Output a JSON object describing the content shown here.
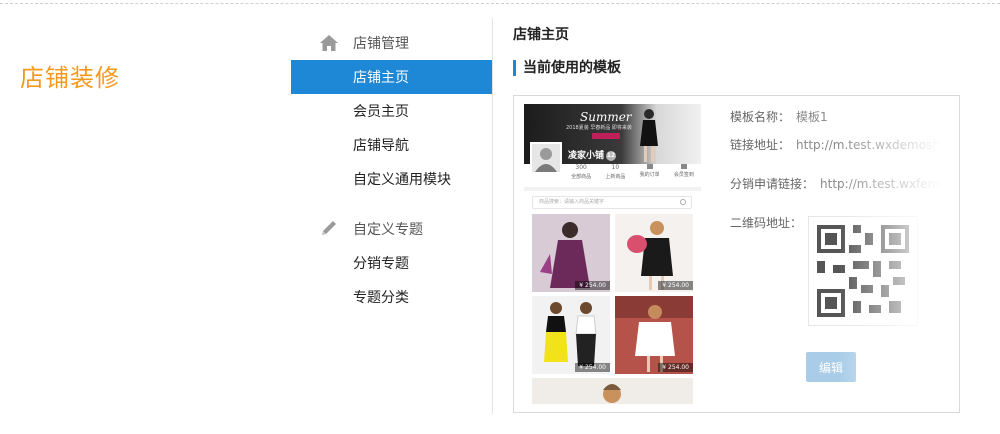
{
  "page_title": "店铺装修",
  "sidebar": {
    "groups": [
      {
        "title": "店铺管理",
        "icon": "home-icon",
        "items": [
          "店铺主页",
          "会员主页",
          "店铺导航",
          "自定义通用模块"
        ]
      },
      {
        "title": "自定义专题",
        "icon": "pencil-icon",
        "items": [
          "分销专题",
          "专题分类"
        ]
      }
    ],
    "active_item": "店铺主页"
  },
  "main": {
    "title": "店铺主页",
    "section_title": "当前使用的模板"
  },
  "preview": {
    "banner_title": "Summer",
    "banner_subtitle": "2018夏装 早春新品 即将来袭",
    "shop_name": "凌家小铺",
    "shop_level": "12",
    "stats": [
      {
        "num": "300",
        "label": "全部商品"
      },
      {
        "num": "10",
        "label": "上新商品"
      },
      {
        "num": "",
        "label": "我的订单"
      },
      {
        "num": "",
        "label": "会员签到"
      }
    ],
    "search_placeholder": "商品搜索：请输入商品关键字",
    "products": [
      {
        "price": "¥ 254.00"
      },
      {
        "price": "¥ 254.00"
      },
      {
        "price": "¥ 254.00"
      },
      {
        "price": "¥ 254.00"
      }
    ]
  },
  "template_info": {
    "name_label": "模板名称：",
    "name_value": "模板1",
    "link_label": "链接地址：",
    "link_value": "http://m.test.wxdemoshop",
    "dist_label": "分销申请链接：",
    "dist_value": "http://m.test.wxfenxiao",
    "qr_label": "二维码地址：",
    "edit_label": "编辑"
  },
  "colors": {
    "accent": "#1e88d6",
    "title_orange": "#f39a1e"
  }
}
